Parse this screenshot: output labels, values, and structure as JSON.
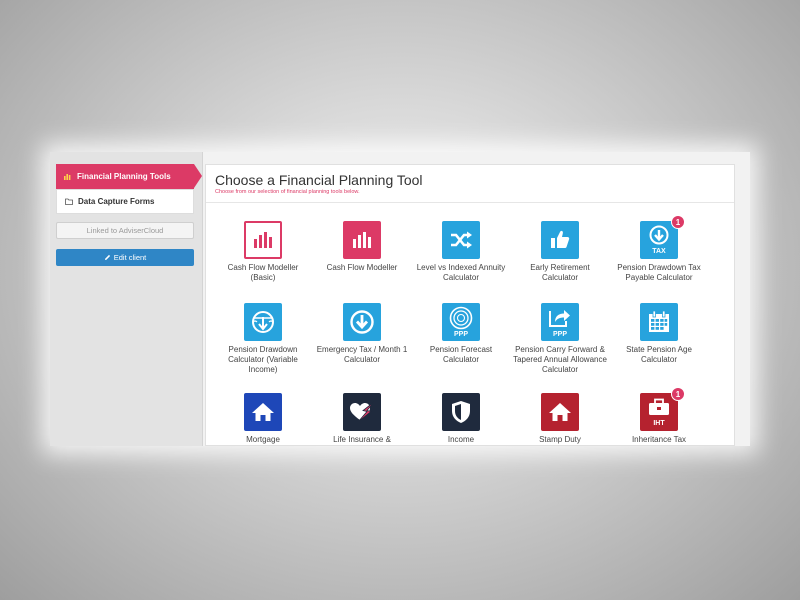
{
  "sidebar": {
    "nav": [
      {
        "label": "Financial Planning Tools",
        "icon": "bar-chart-icon",
        "active": true
      },
      {
        "label": "Data Capture Forms",
        "icon": "folder-icon",
        "active": false
      }
    ],
    "linked_label": "Linked to AdviserCloud",
    "edit_label": "Edit client"
  },
  "main": {
    "title": "Choose a Financial Planning Tool",
    "subtitle": "Choose from our selection of financial planning tools below.",
    "tools": [
      {
        "label": "Cash Flow Modeller (Basic)",
        "icon": "bar-chart-outline-icon",
        "color": "#dc3a66"
      },
      {
        "label": "Cash Flow Modeller",
        "icon": "bar-chart-icon",
        "color": "#dc3a66"
      },
      {
        "label": "Level vs Indexed Annuity Calculator",
        "icon": "shuffle-icon",
        "color": "#27a3dd"
      },
      {
        "label": "Early Retirement Calculator",
        "icon": "thumbs-up-icon",
        "color": "#27a3dd"
      },
      {
        "label": "Pension Drawdown Tax Payable Calculator",
        "icon": "download-tax-icon",
        "icon_text": "TAX",
        "badge": "1",
        "color": "#27a3dd"
      },
      {
        "label": "Pension Drawdown Calculator (Variable Income)",
        "icon": "scales-download-icon",
        "color": "#27a3dd"
      },
      {
        "label": "Emergency Tax / Month 1 Calculator",
        "icon": "download-circle-icon",
        "color": "#27a3dd"
      },
      {
        "label": "Pension Forecast Calculator",
        "icon": "pension-forecast-icon",
        "icon_text": "PPP",
        "color": "#27a3dd"
      },
      {
        "label": "Pension Carry Forward & Tapered Annual Allowance Calculator",
        "icon": "share-ppp-icon",
        "icon_text": "PPP",
        "color": "#27a3dd"
      },
      {
        "label": "State Pension Age Calculator",
        "icon": "calendar-icon",
        "color": "#27a3dd"
      },
      {
        "label": "Mortgage",
        "icon": "house-icon",
        "color": "#1e47b8"
      },
      {
        "label": "Life Insurance &",
        "icon": "heart-bolt-icon",
        "color": "#1f2a3d"
      },
      {
        "label": "Income",
        "icon": "shield-icon",
        "color": "#1f2a3d"
      },
      {
        "label": "Stamp Duty",
        "icon": "house-icon",
        "color": "#b5222f"
      },
      {
        "label": "Inheritance Tax",
        "icon": "briefcase-iht-icon",
        "icon_text": "IHT",
        "badge": "1",
        "color": "#b5222f"
      }
    ]
  }
}
